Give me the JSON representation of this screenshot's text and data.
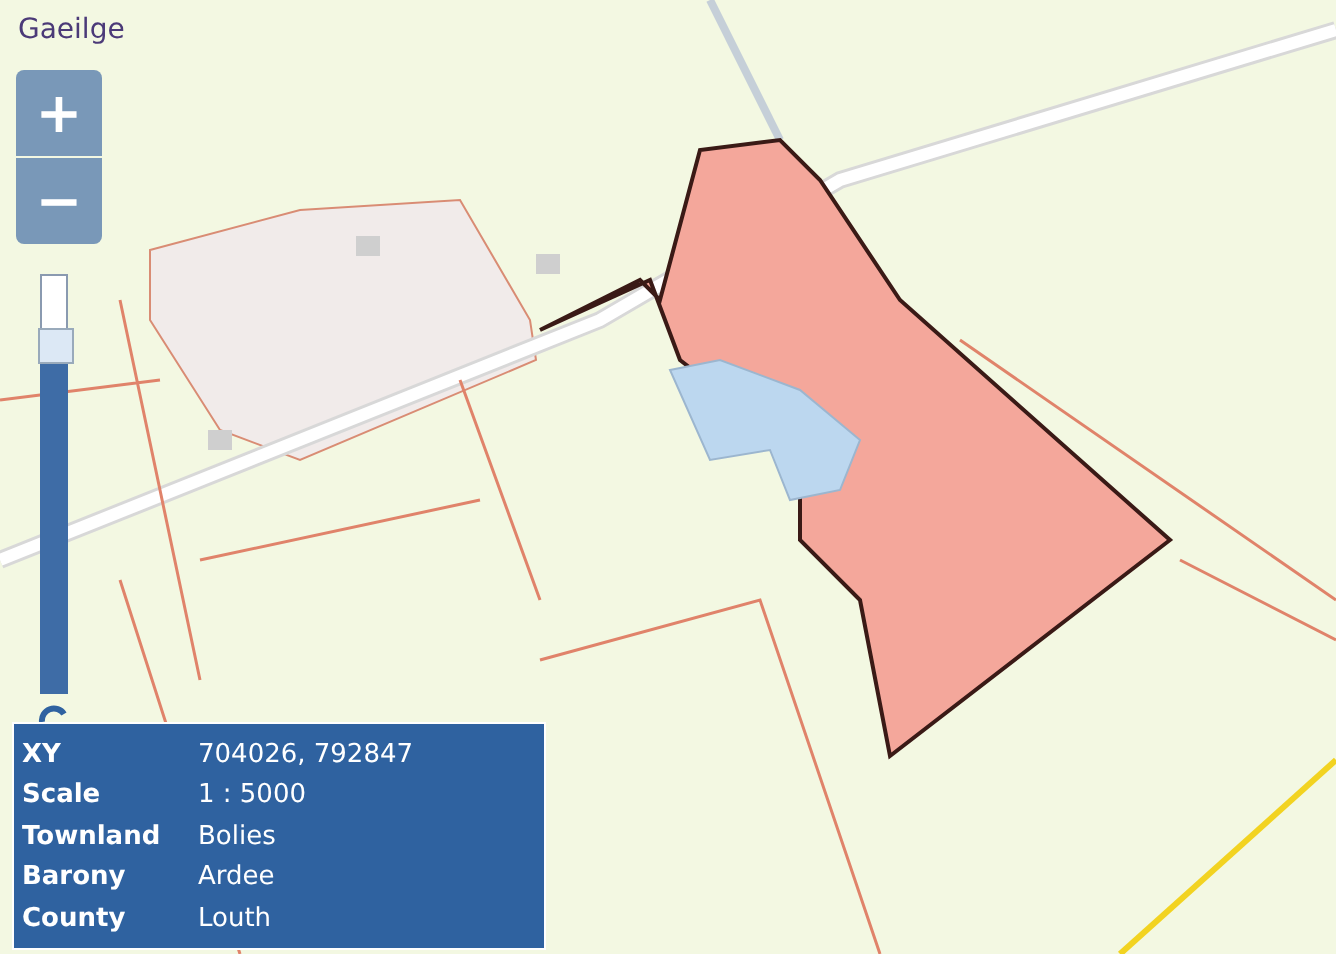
{
  "language_link": "Gaeilge",
  "zoom": {
    "in": "+",
    "out": "−",
    "level": 0.83
  },
  "info": [
    {
      "label": "XY",
      "value": "704026, 792847"
    },
    {
      "label": "Scale",
      "value": "1 : 5000"
    },
    {
      "label": "Townland",
      "value": "Bolies"
    },
    {
      "label": "Barony",
      "value": "Ardee"
    },
    {
      "label": "County",
      "value": "Louth"
    }
  ]
}
